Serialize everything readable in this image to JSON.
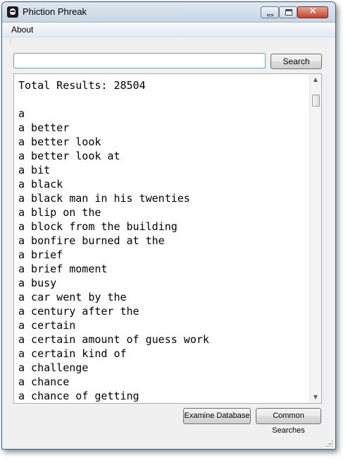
{
  "window": {
    "title": "Phiction Phreak",
    "controls": {
      "minimize": "minimize",
      "maximize": "maximize",
      "close": "✕"
    }
  },
  "menu": {
    "items": [
      {
        "label": "About"
      }
    ]
  },
  "search": {
    "value": "",
    "placeholder": "",
    "button_label": "Search"
  },
  "results": {
    "header": "Total Results: 28504",
    "items": [
      "a",
      "a better",
      "a better look",
      "a better look at",
      "a bit",
      "a black",
      "a black man in his twenties",
      "a blip on the",
      "a block from the building",
      "a bonfire burned at the",
      "a brief",
      "a brief moment",
      "a busy",
      "a car went by the",
      "a century after the",
      "a certain",
      "a certain amount of guess work",
      "a certain kind of",
      "a challenge",
      "a chance",
      "a chance of getting"
    ],
    "scroll_position": 0.03
  },
  "footer": {
    "examine_label": "Examine Database",
    "common_label": "Common Searches"
  },
  "colors": {
    "titlebar": "#c7d5e3",
    "close_button": "#c4432b",
    "window_bg": "#f0f0f0"
  },
  "icons": [
    "app-icon",
    "minimize-icon",
    "maximize-icon",
    "close-icon",
    "scroll-up-arrow-icon",
    "scroll-down-arrow-icon",
    "size-grip-icon"
  ]
}
